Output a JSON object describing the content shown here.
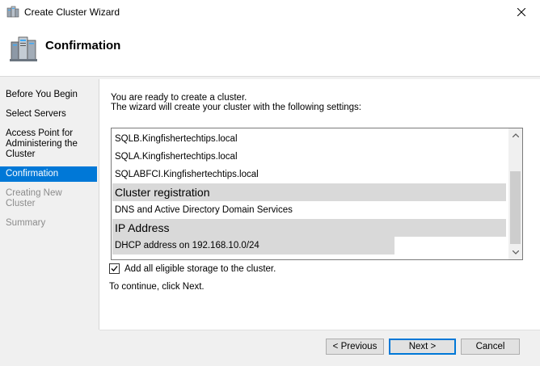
{
  "window": {
    "title": "Create Cluster Wizard"
  },
  "header": {
    "title": "Confirmation"
  },
  "nav": {
    "items": [
      {
        "label": "Before You Begin",
        "state": "normal"
      },
      {
        "label": "Select Servers",
        "state": "normal"
      },
      {
        "label": "Access Point for Administering the Cluster",
        "state": "normal"
      },
      {
        "label": "Confirmation",
        "state": "active"
      },
      {
        "label": "Creating New Cluster",
        "state": "disabled"
      },
      {
        "label": "Summary",
        "state": "disabled"
      }
    ]
  },
  "main": {
    "intro_line1": "You are ready to create a cluster.",
    "intro_line2": "The wizard will create your cluster with the following settings:",
    "settings": {
      "row1": "SQLB.Kingfishertechtips.local",
      "row2": "SQLA.Kingfishertechtips.local",
      "row3": "SQLABFCI.Kingfishertechtips.local",
      "group1": "Cluster registration",
      "row4": "DNS and Active Directory Domain Services",
      "group2": "IP Address",
      "row5": "DHCP address on 192.168.10.0/24"
    },
    "checkbox_label": "Add all eligible storage to the cluster.",
    "checkbox_checked": true,
    "continue_text": "To continue, click Next."
  },
  "buttons": {
    "previous": "< Previous",
    "next": "Next >",
    "cancel": "Cancel"
  },
  "colors": {
    "accent": "#0078d7",
    "group_bg": "#d9d9d9",
    "disabled_text": "#8c8c8c"
  }
}
